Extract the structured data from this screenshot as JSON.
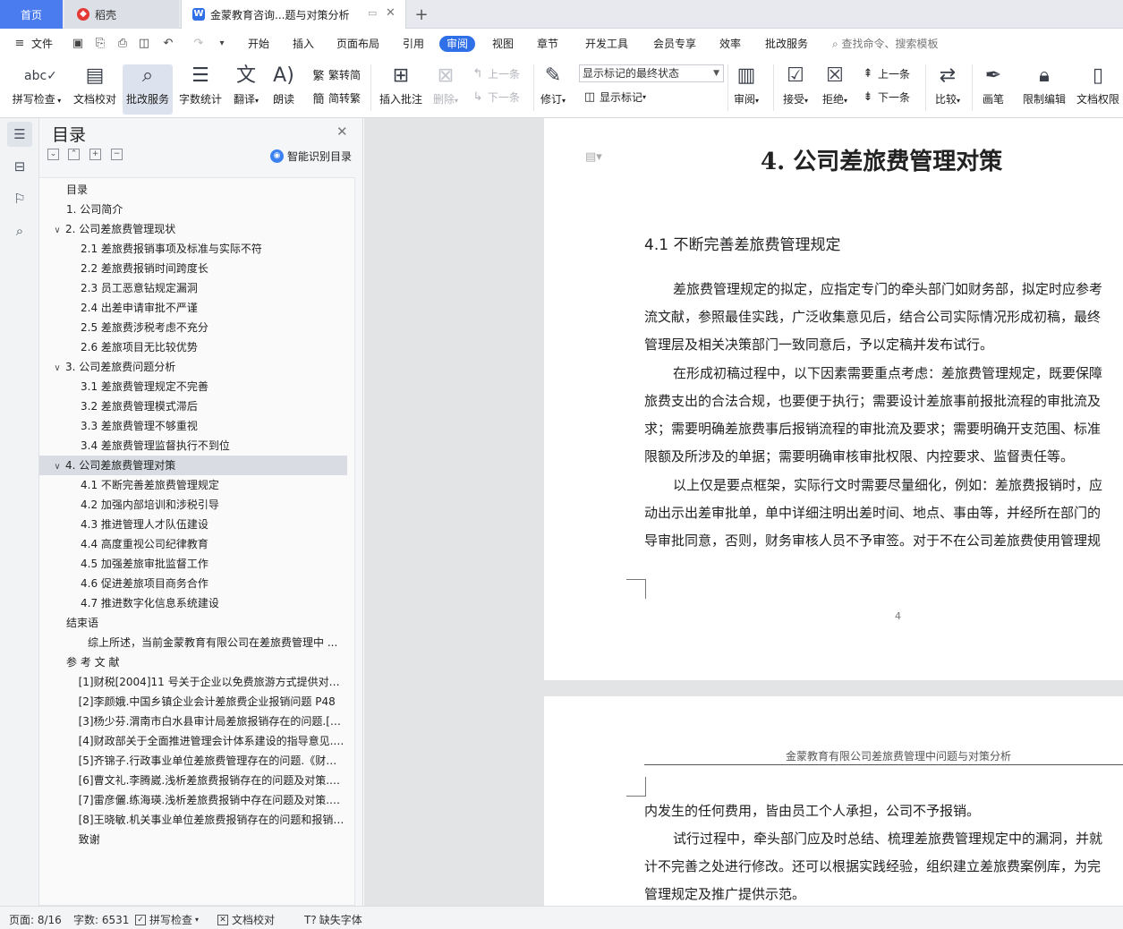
{
  "tabs": {
    "home": "首页",
    "wps": "稻壳",
    "doc": "金蒙教育咨询...题与对策分析",
    "add": "+"
  },
  "menu": {
    "file": "文件",
    "items": [
      "开始",
      "插入",
      "页面布局",
      "引用",
      "审阅",
      "视图",
      "章节",
      "开发工具",
      "会员专享",
      "效率",
      "批改服务"
    ],
    "active": "审阅",
    "search": "查找命令、搜索模板"
  },
  "ribbon": {
    "spell": "拼写检查",
    "proof": "文档校对",
    "correct": "批改服务",
    "wordcount": "字数统计",
    "translate": "翻译",
    "read": "朗读",
    "trad": "繁转简",
    "simp": "简转繁",
    "insert_comment": "插入批注",
    "delete": "删除",
    "prev": "上一条",
    "next": "下一条",
    "revise": "修订",
    "markup_select": "显示标记的最终状态",
    "show_markup": "显示标记",
    "review": "审阅",
    "accept": "接受",
    "reject": "拒绝",
    "prev2": "上一条",
    "next2": "下一条",
    "compare": "比较",
    "pen": "画笔",
    "restrict": "限制编辑",
    "perm": "文档权限"
  },
  "toc": {
    "title": "目录",
    "smart": "智能识别目录",
    "items": [
      {
        "text": "目录",
        "level": 0
      },
      {
        "text": "1. 公司简介",
        "level": 0
      },
      {
        "text": "2. 公司差旅费管理现状",
        "level": 0,
        "caret": "∨"
      },
      {
        "text": "2.1 差旅费报销事项及标准与实际不符",
        "level": 1
      },
      {
        "text": "2.2 差旅费报销时间跨度长",
        "level": 1
      },
      {
        "text": "2.3 员工恶意钻规定漏洞",
        "level": 1
      },
      {
        "text": "2.4 出差申请审批不严谨",
        "level": 1
      },
      {
        "text": "2.5 差旅费涉税考虑不充分",
        "level": 1
      },
      {
        "text": "2.6 差旅项目无比较优势",
        "level": 1
      },
      {
        "text": "3. 公司差旅费问题分析",
        "level": 0,
        "caret": "∨"
      },
      {
        "text": "3.1 差旅费管理规定不完善",
        "level": 1
      },
      {
        "text": "3.2 差旅费管理模式滞后",
        "level": 1
      },
      {
        "text": "3.3 差旅费管理不够重视",
        "level": 1
      },
      {
        "text": "3.4 差旅费管理监督执行不到位",
        "level": 1
      },
      {
        "text": "4. 公司差旅费管理对策",
        "level": 0,
        "caret": "∨",
        "selected": true
      },
      {
        "text": "4.1 不断完善差旅费管理规定",
        "level": 1
      },
      {
        "text": "4.2 加强内部培训和涉税引导",
        "level": 1
      },
      {
        "text": "4.3 推进管理人才队伍建设",
        "level": 1
      },
      {
        "text": "4.4 高度重视公司纪律教育",
        "level": 1
      },
      {
        "text": "4.5 加强差旅审批监督工作",
        "level": 1
      },
      {
        "text": "4.6 促进差旅项目商务合作",
        "level": 1
      },
      {
        "text": "4.7 推进数字化信息系统建设",
        "level": 1
      },
      {
        "text": "结束语",
        "level": 0
      },
      {
        "text": "综上所述，当前金蒙教育有限公司在差旅费管理中 ...",
        "level": 1.5
      },
      {
        "text": "参 考 文 献",
        "level": 0
      },
      {
        "text": "[1]财税[2004]11 号关于企业以免费旅游方式提供对营 ...",
        "level": 0.85
      },
      {
        "text": "[2]李颜娥.中国乡镇企业会计差旅费企业报销问题 P48",
        "level": 0.85
      },
      {
        "text": "[3]杨少芬.渭南市白水县审计局差旅报销存在的问题.[20 ...",
        "level": 0.85
      },
      {
        "text": "[4]财政部关于全面推进管理会计体系建设的指导意见.财 ...",
        "level": 0.85
      },
      {
        "text": "[5]齐锦子.行政事业单位差旅费管理存在的问题.《财富 ...",
        "level": 0.85
      },
      {
        "text": "[6]曹文礼.李腾崴.浅析差旅费报销存在的问题及对策.《 ...",
        "level": 0.85
      },
      {
        "text": "[7]雷彦儷.练海瑛.浅析差旅费报销中存在问题及对策.《 ...",
        "level": 0.85
      },
      {
        "text": "[8]王晓敏.机关事业单位差旅费报销存在的问题和报销流 ...",
        "level": 0.85
      },
      {
        "text": "致谢",
        "level": 0.85
      }
    ]
  },
  "doc": {
    "heading": "4. 公司差旅费管理对策",
    "subheading": "4.1 不断完善差旅费管理规定",
    "p1": [
      "差旅费管理规定的拟定，应指定专门的牵头部门如财务部，拟定时应参考",
      "流文献，参照最佳实践，广泛收集意见后，结合公司实际情况形成初稿，最终",
      "管理层及相关决策部门一致同意后，予以定稿并发布试行。"
    ],
    "p2": [
      "在形成初稿过程中，以下因素需要重点考虑：差旅费管理规定，既要保障",
      "旅费支出的合法合规，也要便于执行；需要设计差旅事前报批流程的审批流及",
      "求；需要明确差旅费事后报销流程的审批流及要求；需要明确开支范围、标准",
      "限额及所涉及的单据；需要明确审核审批权限、内控要求、监督责任等。"
    ],
    "p3": [
      "以上仅是要点框架，实际行文时需要尽量细化，例如：差旅费报销时，应",
      "动出示出差审批单，单中详细注明出差时间、地点、事由等，并经所在部门的",
      "导审批同意，否则，财务审核人员不予审签。对于不在公司差旅费使用管理规"
    ],
    "page_number": "4",
    "header2": "金蒙教育有限公司差旅费管理中问题与对策分析",
    "p4": [
      "内发生的任何费用，皆由员工个人承担，公司不予报销。",
      "试行过程中，牵头部门应及时总结、梳理差旅费管理规定中的漏洞，并就",
      "计不完善之处进行修改。还可以根据实践经验，组织建立差旅费案例库，为完",
      "管理规定及推广提供示范。"
    ]
  },
  "status": {
    "page": "页面: 8/16",
    "words": "字数: 6531",
    "spell": "拼写检查",
    "proof": "文档校对",
    "missing_font": "缺失字体"
  },
  "colors": {
    "accent": "#2f6fe8",
    "home_tab": "#4a7cf0"
  }
}
